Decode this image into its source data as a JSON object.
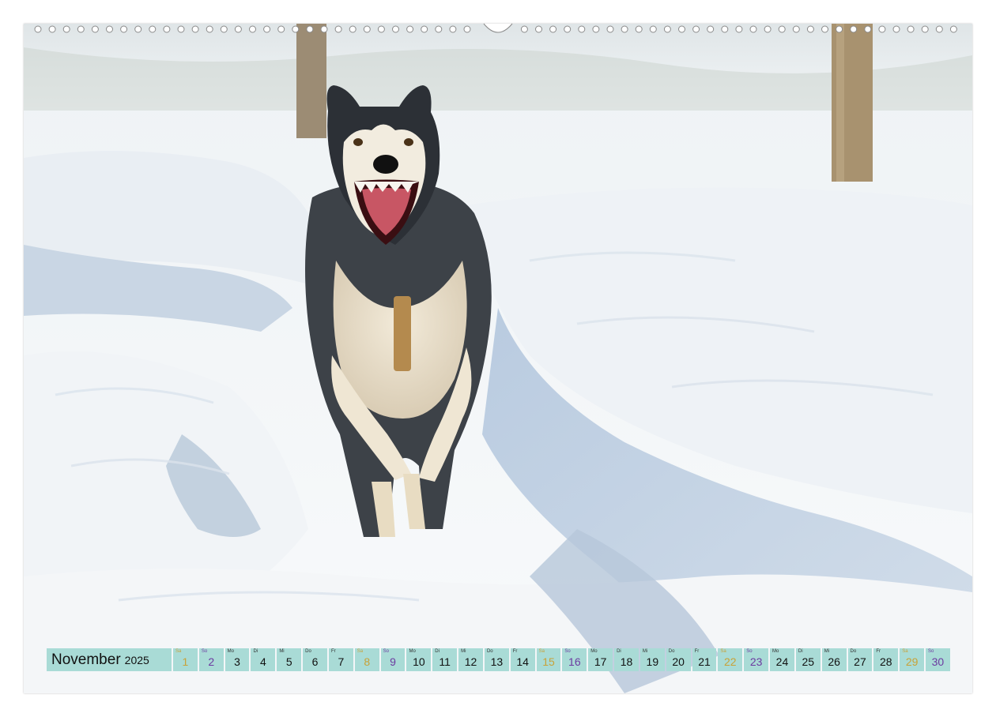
{
  "calendar": {
    "month": "November",
    "year": "2025",
    "days": [
      {
        "abbr": "Sa",
        "num": "1",
        "type": "sat"
      },
      {
        "abbr": "So",
        "num": "2",
        "type": "sun"
      },
      {
        "abbr": "Mo",
        "num": "3",
        "type": "weekday"
      },
      {
        "abbr": "Di",
        "num": "4",
        "type": "weekday"
      },
      {
        "abbr": "Mi",
        "num": "5",
        "type": "weekday"
      },
      {
        "abbr": "Do",
        "num": "6",
        "type": "weekday"
      },
      {
        "abbr": "Fr",
        "num": "7",
        "type": "weekday"
      },
      {
        "abbr": "Sa",
        "num": "8",
        "type": "sat"
      },
      {
        "abbr": "So",
        "num": "9",
        "type": "sun"
      },
      {
        "abbr": "Mo",
        "num": "10",
        "type": "weekday"
      },
      {
        "abbr": "Di",
        "num": "11",
        "type": "weekday"
      },
      {
        "abbr": "Mi",
        "num": "12",
        "type": "weekday"
      },
      {
        "abbr": "Do",
        "num": "13",
        "type": "weekday"
      },
      {
        "abbr": "Fr",
        "num": "14",
        "type": "weekday"
      },
      {
        "abbr": "Sa",
        "num": "15",
        "type": "sat"
      },
      {
        "abbr": "So",
        "num": "16",
        "type": "sun"
      },
      {
        "abbr": "Mo",
        "num": "17",
        "type": "weekday"
      },
      {
        "abbr": "Di",
        "num": "18",
        "type": "weekday"
      },
      {
        "abbr": "Mi",
        "num": "19",
        "type": "weekday"
      },
      {
        "abbr": "Do",
        "num": "20",
        "type": "weekday"
      },
      {
        "abbr": "Fr",
        "num": "21",
        "type": "weekday"
      },
      {
        "abbr": "Sa",
        "num": "22",
        "type": "sat"
      },
      {
        "abbr": "So",
        "num": "23",
        "type": "sun"
      },
      {
        "abbr": "Mo",
        "num": "24",
        "type": "weekday"
      },
      {
        "abbr": "Di",
        "num": "25",
        "type": "weekday"
      },
      {
        "abbr": "Mi",
        "num": "26",
        "type": "weekday"
      },
      {
        "abbr": "Do",
        "num": "27",
        "type": "weekday"
      },
      {
        "abbr": "Fr",
        "num": "28",
        "type": "weekday"
      },
      {
        "abbr": "Sa",
        "num": "29",
        "type": "sat"
      },
      {
        "abbr": "So",
        "num": "30",
        "type": "sun"
      }
    ]
  },
  "colors": {
    "strip_background": "#a9dbd6",
    "saturday": "#c8a238",
    "sunday": "#6c3aa0"
  },
  "icons": {
    "binding": "wire-binding-icon"
  }
}
